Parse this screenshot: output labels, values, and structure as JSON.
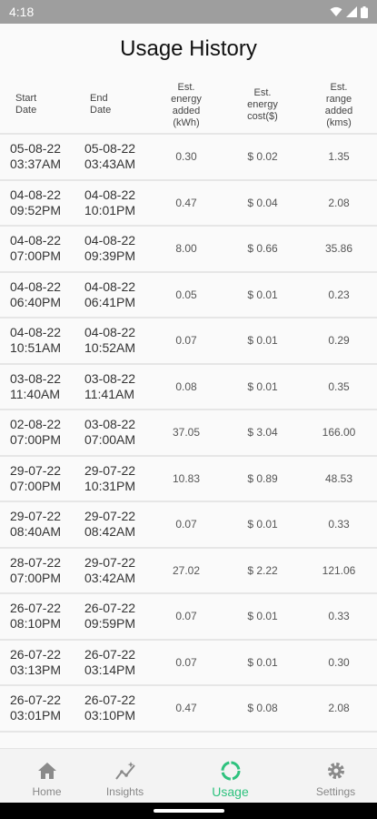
{
  "status_bar": {
    "time": "4:18"
  },
  "title": "Usage History",
  "headers": {
    "start_date": "Start\nDate",
    "end_date": "End\nDate",
    "energy": "Est.\nenergy\nadded\n(kWh)",
    "cost": "Est.\nenergy\ncost($)",
    "range": "Est.\nrange\nadded\n(kms)"
  },
  "rows": [
    {
      "start": "05-08-22\n03:37AM",
      "end": "05-08-22\n03:43AM",
      "energy": "0.30",
      "cost": "$ 0.02",
      "range": "1.35"
    },
    {
      "start": "04-08-22\n09:52PM",
      "end": "04-08-22\n10:01PM",
      "energy": "0.47",
      "cost": "$ 0.04",
      "range": "2.08"
    },
    {
      "start": "04-08-22\n07:00PM",
      "end": "04-08-22\n09:39PM",
      "energy": "8.00",
      "cost": "$ 0.66",
      "range": "35.86"
    },
    {
      "start": "04-08-22\n06:40PM",
      "end": "04-08-22\n06:41PM",
      "energy": "0.05",
      "cost": "$ 0.01",
      "range": "0.23"
    },
    {
      "start": "04-08-22\n10:51AM",
      "end": "04-08-22\n10:52AM",
      "energy": "0.07",
      "cost": "$ 0.01",
      "range": "0.29"
    },
    {
      "start": "03-08-22\n11:40AM",
      "end": "03-08-22\n11:41AM",
      "energy": "0.08",
      "cost": "$ 0.01",
      "range": "0.35"
    },
    {
      "start": "02-08-22\n07:00PM",
      "end": "03-08-22\n07:00AM",
      "energy": "37.05",
      "cost": "$ 3.04",
      "range": "166.00"
    },
    {
      "start": "29-07-22\n07:00PM",
      "end": "29-07-22\n10:31PM",
      "energy": "10.83",
      "cost": "$ 0.89",
      "range": "48.53"
    },
    {
      "start": "29-07-22\n08:40AM",
      "end": "29-07-22\n08:42AM",
      "energy": "0.07",
      "cost": "$ 0.01",
      "range": "0.33"
    },
    {
      "start": "28-07-22\n07:00PM",
      "end": "29-07-22\n03:42AM",
      "energy": "27.02",
      "cost": "$ 2.22",
      "range": "121.06"
    },
    {
      "start": "26-07-22\n08:10PM",
      "end": "26-07-22\n09:59PM",
      "energy": "0.07",
      "cost": "$ 0.01",
      "range": "0.33"
    },
    {
      "start": "26-07-22\n03:13PM",
      "end": "26-07-22\n03:14PM",
      "energy": "0.07",
      "cost": "$ 0.01",
      "range": "0.30"
    },
    {
      "start": "26-07-22\n03:01PM",
      "end": "26-07-22\n03:10PM",
      "energy": "0.47",
      "cost": "$ 0.08",
      "range": "2.08"
    }
  ],
  "nav": [
    {
      "label": "Home",
      "icon": "home-icon",
      "active": false
    },
    {
      "label": "Insights",
      "icon": "insights-icon",
      "active": false
    },
    {
      "label": "Usage",
      "icon": "usage-icon",
      "active": true
    },
    {
      "label": "Settings",
      "icon": "settings-icon",
      "active": false
    }
  ],
  "colors": {
    "accent": "#2ec27e",
    "status_bar": "#9e9e9e",
    "inactive": "#888888"
  }
}
